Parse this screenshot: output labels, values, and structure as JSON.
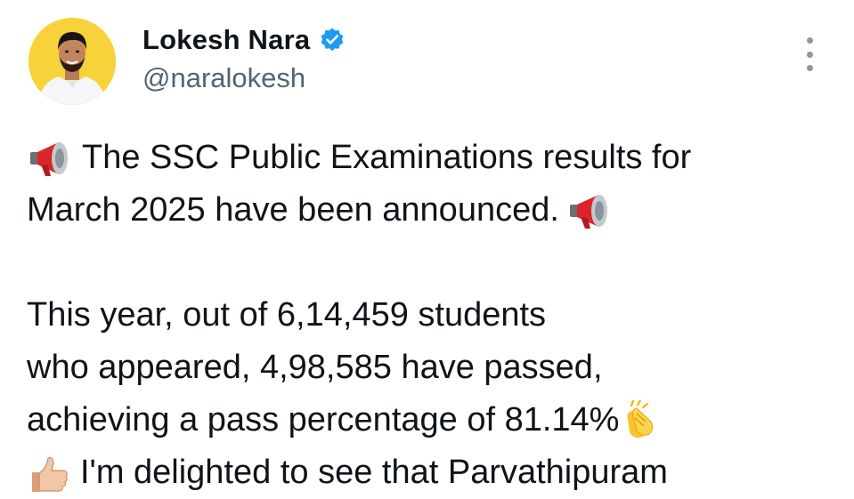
{
  "author": {
    "display_name": "Lokesh Nara",
    "handle": "@naralokesh",
    "verified": true,
    "avatar_bg": "#f7d23a"
  },
  "icons": {
    "verified": "verified-badge-icon",
    "more": "more-vertical-icon",
    "megaphone": "megaphone-emoji",
    "clap": "clapping-hands-emoji",
    "thumbs_up": "thumbs-up-emoji"
  },
  "colors": {
    "text": "#0f1419",
    "secondary": "#536471",
    "verified_blue": "#1d9bf0"
  },
  "tweet": {
    "line1": "The SSC Public Examinations results for",
    "line2": "March 2025 have been announced.",
    "line3": "This year, out of 6,14,459 students",
    "line4": "who appeared, 4,98,585 have passed,",
    "line5": "achieving a pass percentage of 81.14%",
    "line6": "I'm delighted to see that Parvathipuram"
  }
}
